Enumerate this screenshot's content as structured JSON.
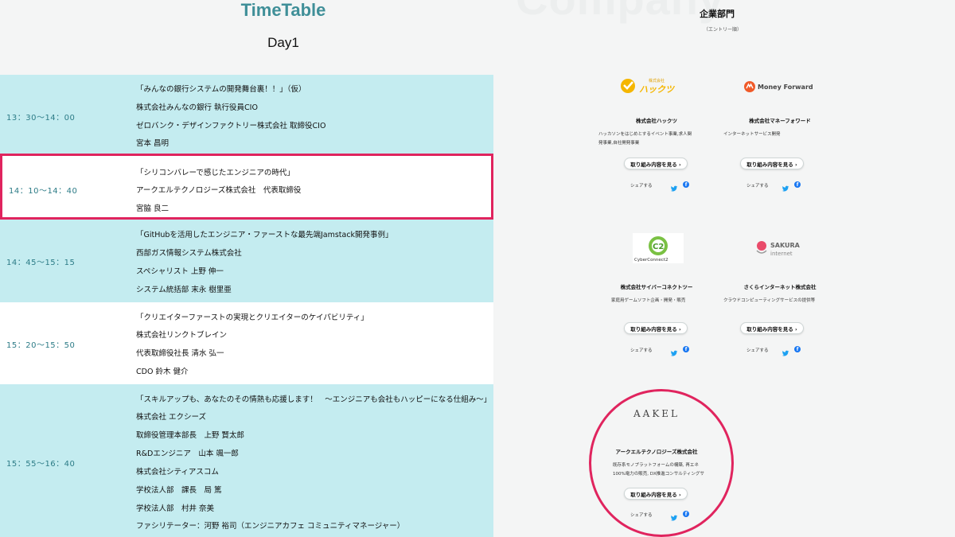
{
  "timetable": {
    "title": "TimeTable",
    "day": "Day1",
    "sessions": [
      {
        "time": "13：30〜14：00",
        "lines": [
          "「みんなの銀行システムの開発舞台裏！！」（仮）",
          "株式会社みんなの銀行 執行役員CIO",
          "ゼロバンク・デザインファクトリー株式会社 取締役CIO",
          "宮本 昌明"
        ]
      },
      {
        "time": "14：10〜14：40",
        "lines": [
          "「シリコンバレーで感じたエンジニアの時代」",
          "アークエルテクノロジーズ株式会社　代表取締役",
          "宮脇 良二"
        ]
      },
      {
        "time": "14：45〜15：15",
        "lines": [
          "「GitHubを活用したエンジニア・ファーストな最先端Jamstack開発事例」",
          "西部ガス情報システム株式会社",
          "スペシャリスト 上野 伸一",
          "システム統括部 末永 樹里亜"
        ]
      },
      {
        "time": "15：20〜15：50",
        "lines": [
          "「クリエイターファーストの実現とクリエイターのケイパビリティ」",
          "株式会社リンクトブレイン",
          "代表取締役社長 清水 弘一",
          "CDO 鈴木 健介"
        ]
      },
      {
        "time": "15：55〜16：40",
        "lines": [
          "「スキルアップも、あなたのその情熱も応援します！　〜エンジニアも会社もハッピーになる仕組み〜」",
          "株式会社 エクシーズ",
          "取締役管理本部長　上野 賢太郎",
          "R&Dエンジニア　山本 颯一郎",
          "株式会社シティアスコム",
          "学校法人部　課長　局 篤",
          "学校法人部　村井 奈美",
          "ファシリテーター：河野 裕司（エンジニアカフェ コミュニティマネージャー）"
        ]
      }
    ]
  },
  "company": {
    "watermark": "Company",
    "section_title": "企業部門",
    "section_sub": "（エントリー順）",
    "button_label": "取り組み内容を見る ›",
    "share_label": "シェアする",
    "cards": [
      {
        "logo_sub": "株式会社",
        "logo_text": "ハックツ",
        "name": "株式会社ハックツ",
        "desc": [
          "ハッカソンをはじめとするイベント事業,求人関",
          "発事業,自社開発事業"
        ]
      },
      {
        "logo_text": "Money Forward",
        "name": "株式会社マネーフォワード",
        "desc": [
          "インターネットサービス開発"
        ]
      },
      {
        "logo_text": "CyberConnect2",
        "name": "株式会社サイバーコネクトツー",
        "desc": [
          "家庭用ゲームソフト企画・開発・販売"
        ]
      },
      {
        "logo_text": "SAKURA",
        "logo_text2": "internet",
        "name": "さくらインターネット株式会社",
        "desc": [
          "クラウドコンピューティングサービスの提供等"
        ]
      },
      {
        "logo_text": "AAKEL",
        "name": "アークエルテクノロジーズ株式会社",
        "desc": [
          "既存系モノプラットフォームの構築, 再エネ",
          "100%電力の販売, DX推進コンサルティングサ"
        ]
      }
    ]
  },
  "colors": {
    "accent": "#3f8f98",
    "highlight": "#e0245e",
    "row_cyan": "#c4ecf0"
  }
}
